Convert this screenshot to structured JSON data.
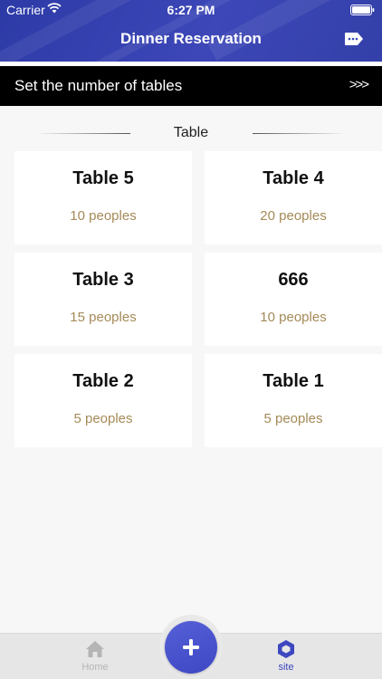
{
  "status_bar": {
    "carrier": "Carrier",
    "time": "6:27 PM"
  },
  "header": {
    "title": "Dinner Reservation",
    "action_icon": "tag-arrow-icon"
  },
  "banner": {
    "label": "Set the number of tables",
    "arrows": ">>>"
  },
  "section": {
    "title": "Table"
  },
  "tables": [
    {
      "name": "Table 5",
      "count": "10 peoples"
    },
    {
      "name": "Table 4",
      "count": "20 peoples"
    },
    {
      "name": "Table 3",
      "count": "15 peoples"
    },
    {
      "name": "666",
      "count": "10 peoples"
    },
    {
      "name": "Table 2",
      "count": "5 peoples"
    },
    {
      "name": "Table 1",
      "count": "5 peoples"
    }
  ],
  "tabbar": {
    "home_label": "Home",
    "site_label": "site",
    "fab_icon": "plus-icon"
  },
  "colors": {
    "header": "#3d47b8",
    "accent": "#3e47c2",
    "count_text": "#a58a58",
    "banner": "#000000"
  }
}
